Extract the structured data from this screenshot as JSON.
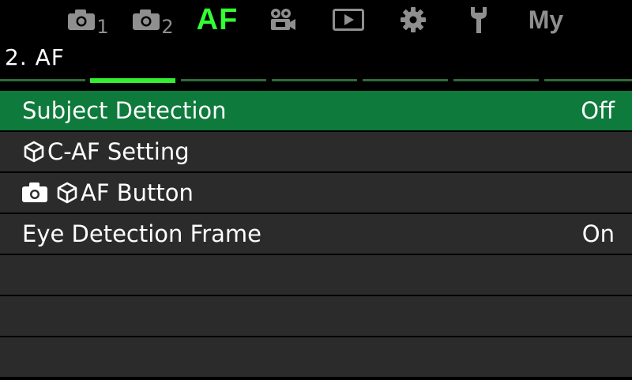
{
  "tabs": [
    {
      "name": "tab-shooting-1",
      "icon": "camera-icon",
      "sub": "1"
    },
    {
      "name": "tab-shooting-2",
      "icon": "camera-icon",
      "sub": "2"
    },
    {
      "name": "tab-af",
      "label": "AF",
      "active": true
    },
    {
      "name": "tab-video",
      "icon": "movie-camera-icon"
    },
    {
      "name": "tab-playback",
      "icon": "play-icon"
    },
    {
      "name": "tab-settings",
      "icon": "gear-icon"
    },
    {
      "name": "tab-custom",
      "icon": "wrench-icon"
    },
    {
      "name": "tab-my-menu",
      "label": "My"
    }
  ],
  "page": {
    "title": "2. AF",
    "current_page": 2,
    "total_pages": 7
  },
  "colors": {
    "accent": "#33ff33",
    "selected_row": "#0e7a3c",
    "row_bg": "#2b2b2b",
    "inactive_icon": "#8f8f8f"
  },
  "menu": {
    "items": [
      {
        "label": "Subject Detection",
        "value": "Off",
        "selected": true
      },
      {
        "label": "C-AF Setting",
        "icons": [
          "af-target-icon"
        ],
        "value": ""
      },
      {
        "label": "AF Button",
        "icons": [
          "camera-icon",
          "af-target-icon"
        ],
        "value": ""
      },
      {
        "label": "Eye Detection Frame",
        "value": "On"
      }
    ]
  }
}
